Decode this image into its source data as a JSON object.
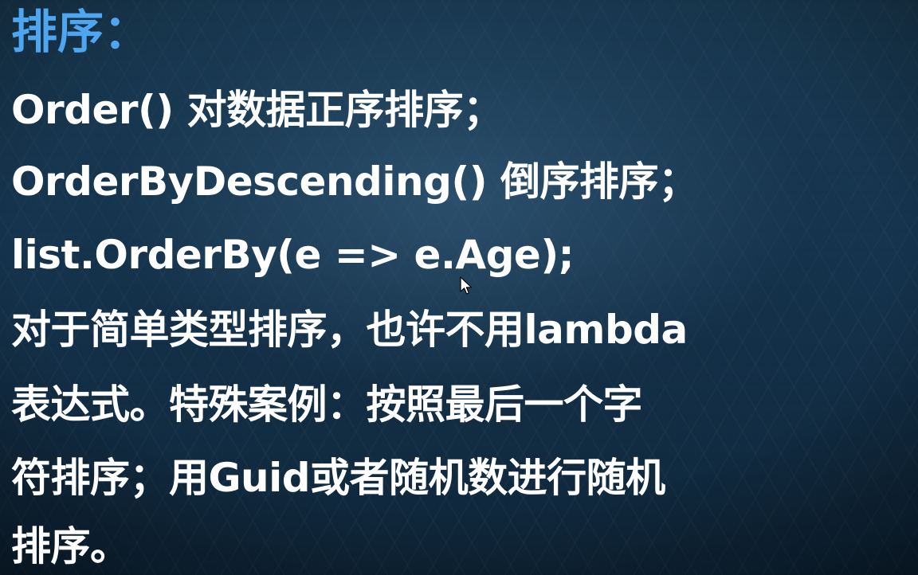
{
  "colors": {
    "title": "#4ea6f0",
    "text": "#ffffff",
    "background": "#163550"
  },
  "slide": {
    "title": "排序：",
    "lines": [
      "Order() 对数据正序排序；",
      "OrderByDescending() 倒序排序；",
      "list.OrderBy(e => e.Age);",
      "对于简单类型排序，也许不用lambda",
      "表达式。特殊案例：按照最后一个字",
      "符排序；用Guid或者随机数进行随机",
      "排序。"
    ]
  },
  "cursor": {
    "icon": "mouse-pointer-icon"
  }
}
